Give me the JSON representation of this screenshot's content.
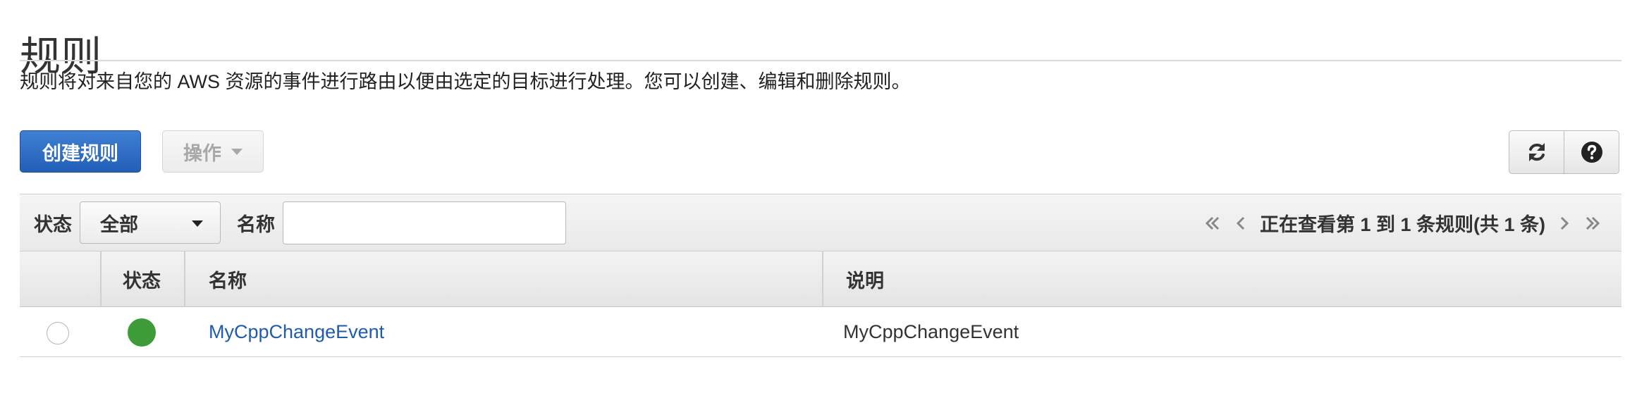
{
  "page": {
    "title": "规则",
    "description": "规则将对来自您的 AWS 资源的事件进行路由以便由选定的目标进行处理。您可以创建、编辑和删除规则。"
  },
  "toolbar": {
    "create_label": "创建规则",
    "actions_label": "操作",
    "refresh_icon": "refresh-icon",
    "help_icon": "help-icon"
  },
  "filter": {
    "status_label": "状态",
    "status_value": "全部",
    "name_label": "名称",
    "name_value": "",
    "name_placeholder": ""
  },
  "pagination": {
    "text": "正在查看第 1 到 1 条规则(共 1 条)",
    "first_icon": "double-chevron-left-icon",
    "prev_icon": "chevron-left-icon",
    "next_icon": "chevron-right-icon",
    "last_icon": "double-chevron-right-icon"
  },
  "table": {
    "columns": [
      "",
      "状态",
      "名称",
      "说明"
    ],
    "rows": [
      {
        "selected": false,
        "status": "enabled",
        "status_color": "#3d9b38",
        "name": "MyCppChangeEvent",
        "description": "MyCppChangeEvent"
      }
    ]
  },
  "colors": {
    "primary": "#2b6cc4",
    "link": "#1f5cad",
    "status_enabled": "#3d9b38"
  }
}
